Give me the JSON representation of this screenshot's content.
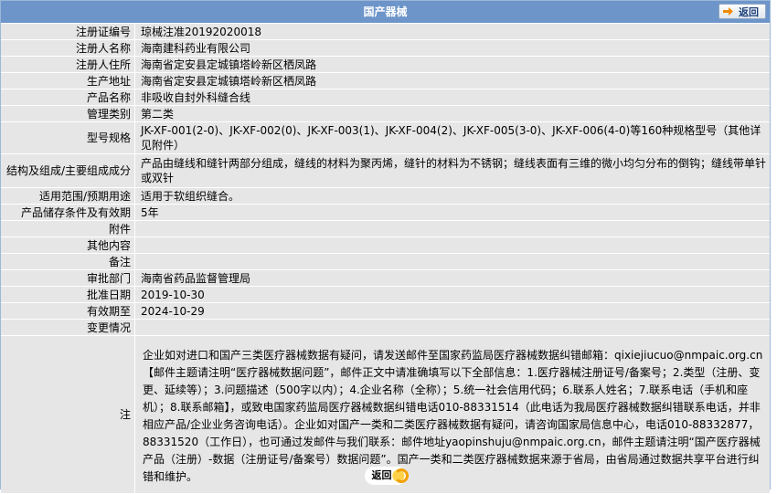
{
  "header": {
    "title": "国产器械",
    "back_label": "返回"
  },
  "fields": [
    {
      "label": "注册证编号",
      "value": "琼械注准20192020018"
    },
    {
      "label": "注册人名称",
      "value": "海南建科药业有限公司"
    },
    {
      "label": "注册人住所",
      "value": "海南省定安县定城镇塔岭新区栖凤路"
    },
    {
      "label": "生产地址",
      "value": "海南省定安县定城镇塔岭新区栖凤路"
    },
    {
      "label": "产品名称",
      "value": "非吸收自封外科缝合线"
    },
    {
      "label": "管理类别",
      "value": "第二类"
    },
    {
      "label": "型号规格",
      "value": "JK-XF-001(2-0)、JK-XF-002(0)、JK-XF-003(1)、JK-XF-004(2)、JK-XF-005(3-0)、JK-XF-006(4-0)等160种规格型号（其他详见附件）"
    },
    {
      "label": "结构及组成/主要组成成分",
      "value": "产品由缝线和缝针两部分组成，缝线的材料为聚丙烯，缝针的材料为不锈钢；缝线表面有三维的微小均匀分布的倒钩；缝线带单针或双针"
    },
    {
      "label": "适用范围/预期用途",
      "value": "适用于软组织缝合。"
    },
    {
      "label": "产品储存条件及有效期",
      "value": "5年"
    },
    {
      "label": "附件",
      "value": ""
    },
    {
      "label": "其他内容",
      "value": ""
    },
    {
      "label": "备注",
      "value": ""
    },
    {
      "label": "审批部门",
      "value": "海南省药品监督管理局"
    },
    {
      "label": "批准日期",
      "value": "2019-10-30"
    },
    {
      "label": "有效期至",
      "value": "2024-10-29"
    },
    {
      "label": "变更情况",
      "value": ""
    }
  ],
  "notes": {
    "label": "注",
    "text": "企业如对进口和国产三类医疗器械数据有疑问，请发送邮件至国家药监局医疗器械数据纠错邮箱：qixiejiucuo@nmpaic.org.cn【邮件主题请注明“医疗器械数据问题”，邮件正文中请准确填写以下全部信息：1.医疗器械注册证号/备案号；2.类型（注册、变更、延续等）；3.问题描述（500字以内）；4.企业名称（全称）；5.统一社会信用代码；6.联系人姓名；7.联系电话（手机和座机）；8.联系邮箱】，或致电国家药监局医疗器械数据纠错电话010-88331514（此电话为我局医疗器械数据纠错联系电话，并非相应产品/企业业务咨询电话）。企业如对国产一类和二类医疗器械数据有疑问，请咨询国家局信息中心，电话010-88332877，88331520（工作日），也可通过发邮件与我们联系：邮件地址yaopinshuju@nmpaic.org.cn，邮件主题请注明“国产医疗器械产品（注册）-数据（注册证号/备案号）数据问题”。国产一类和二类医疗器械数据来源于省局，由省局通过数据共享平台进行纠错和维护。"
  },
  "footer": {
    "back_label": "返回"
  },
  "colors": {
    "header": "#6d95c9",
    "row": "#e6e6e6",
    "link": "#1a3f7a",
    "button_accent": "#f2a000"
  }
}
